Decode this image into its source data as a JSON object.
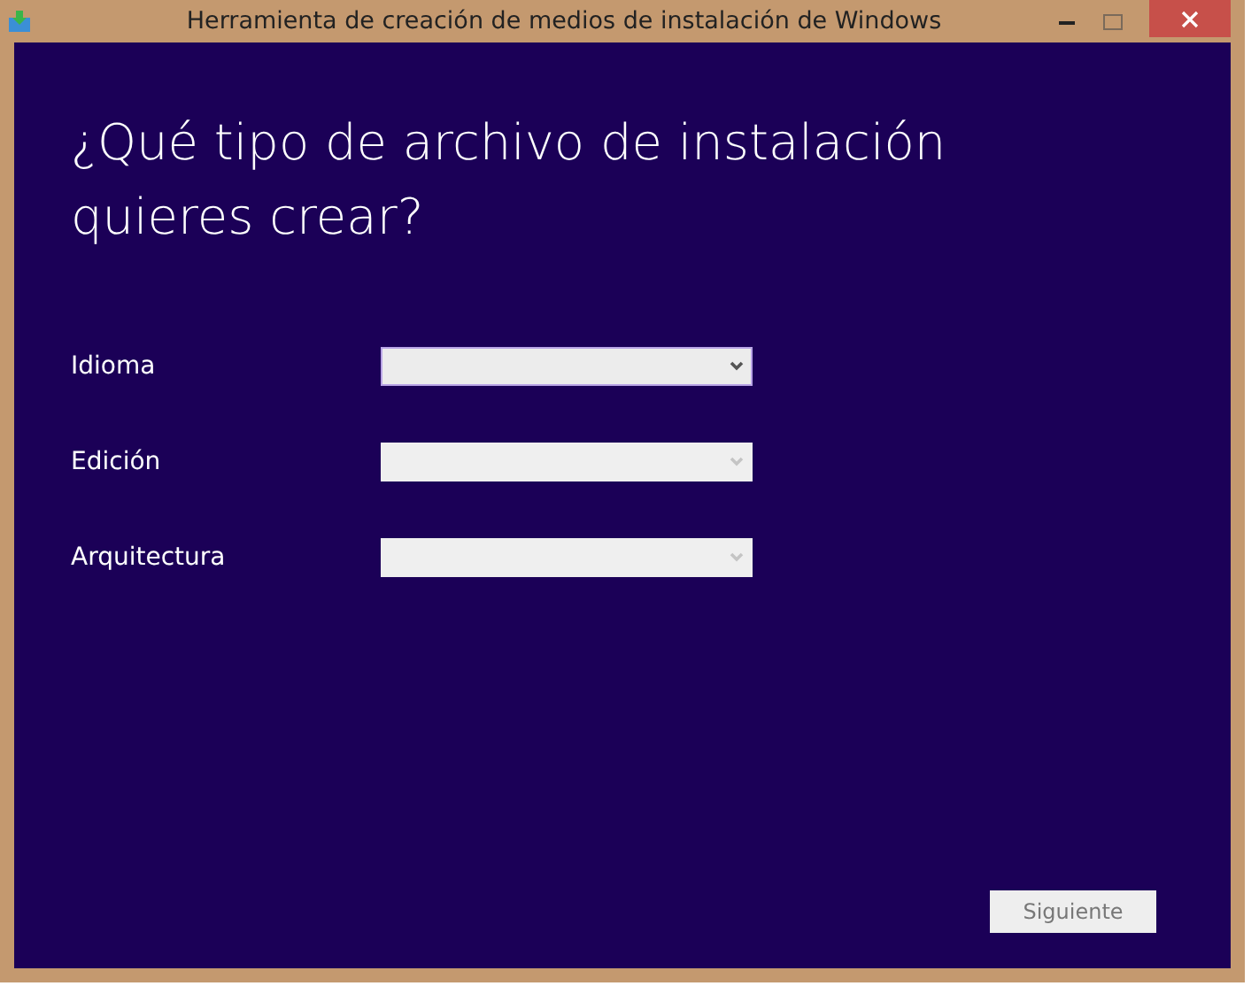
{
  "window": {
    "title": "Herramienta de creación de medios de instalación de Windows"
  },
  "heading": "¿Qué tipo de archivo de instalación quieres crear?",
  "fields": [
    {
      "label": "Idioma",
      "disabled": false
    },
    {
      "label": "Edición",
      "disabled": true
    },
    {
      "label": "Arquitectura",
      "disabled": true
    }
  ],
  "next_button": {
    "label": "Siguiente",
    "disabled": true
  }
}
